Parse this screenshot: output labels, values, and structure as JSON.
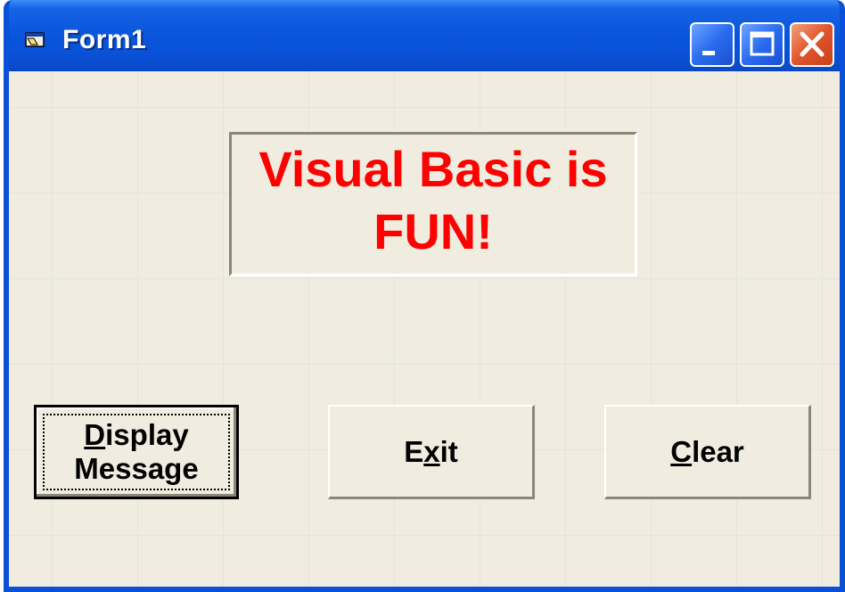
{
  "window": {
    "title": "Form1",
    "icon": "vb-form-icon",
    "controls": {
      "minimize_icon": "minimize-icon",
      "maximize_icon": "maximize-icon",
      "close_icon": "close-icon"
    }
  },
  "label": {
    "line1": "Visual Basic is",
    "line2": "FUN!",
    "color": "#ff0000"
  },
  "buttons": {
    "display": {
      "line1_accel": "D",
      "line1_rest": "isplay",
      "line2": "Message"
    },
    "exit": {
      "pre": "E",
      "accel": "x",
      "post": "it"
    },
    "clear": {
      "accel": "C",
      "rest": "lear"
    }
  },
  "colors": {
    "titlebar": "#0a56dc",
    "form_background": "#f0ede0",
    "close_button": "#e0552a"
  }
}
